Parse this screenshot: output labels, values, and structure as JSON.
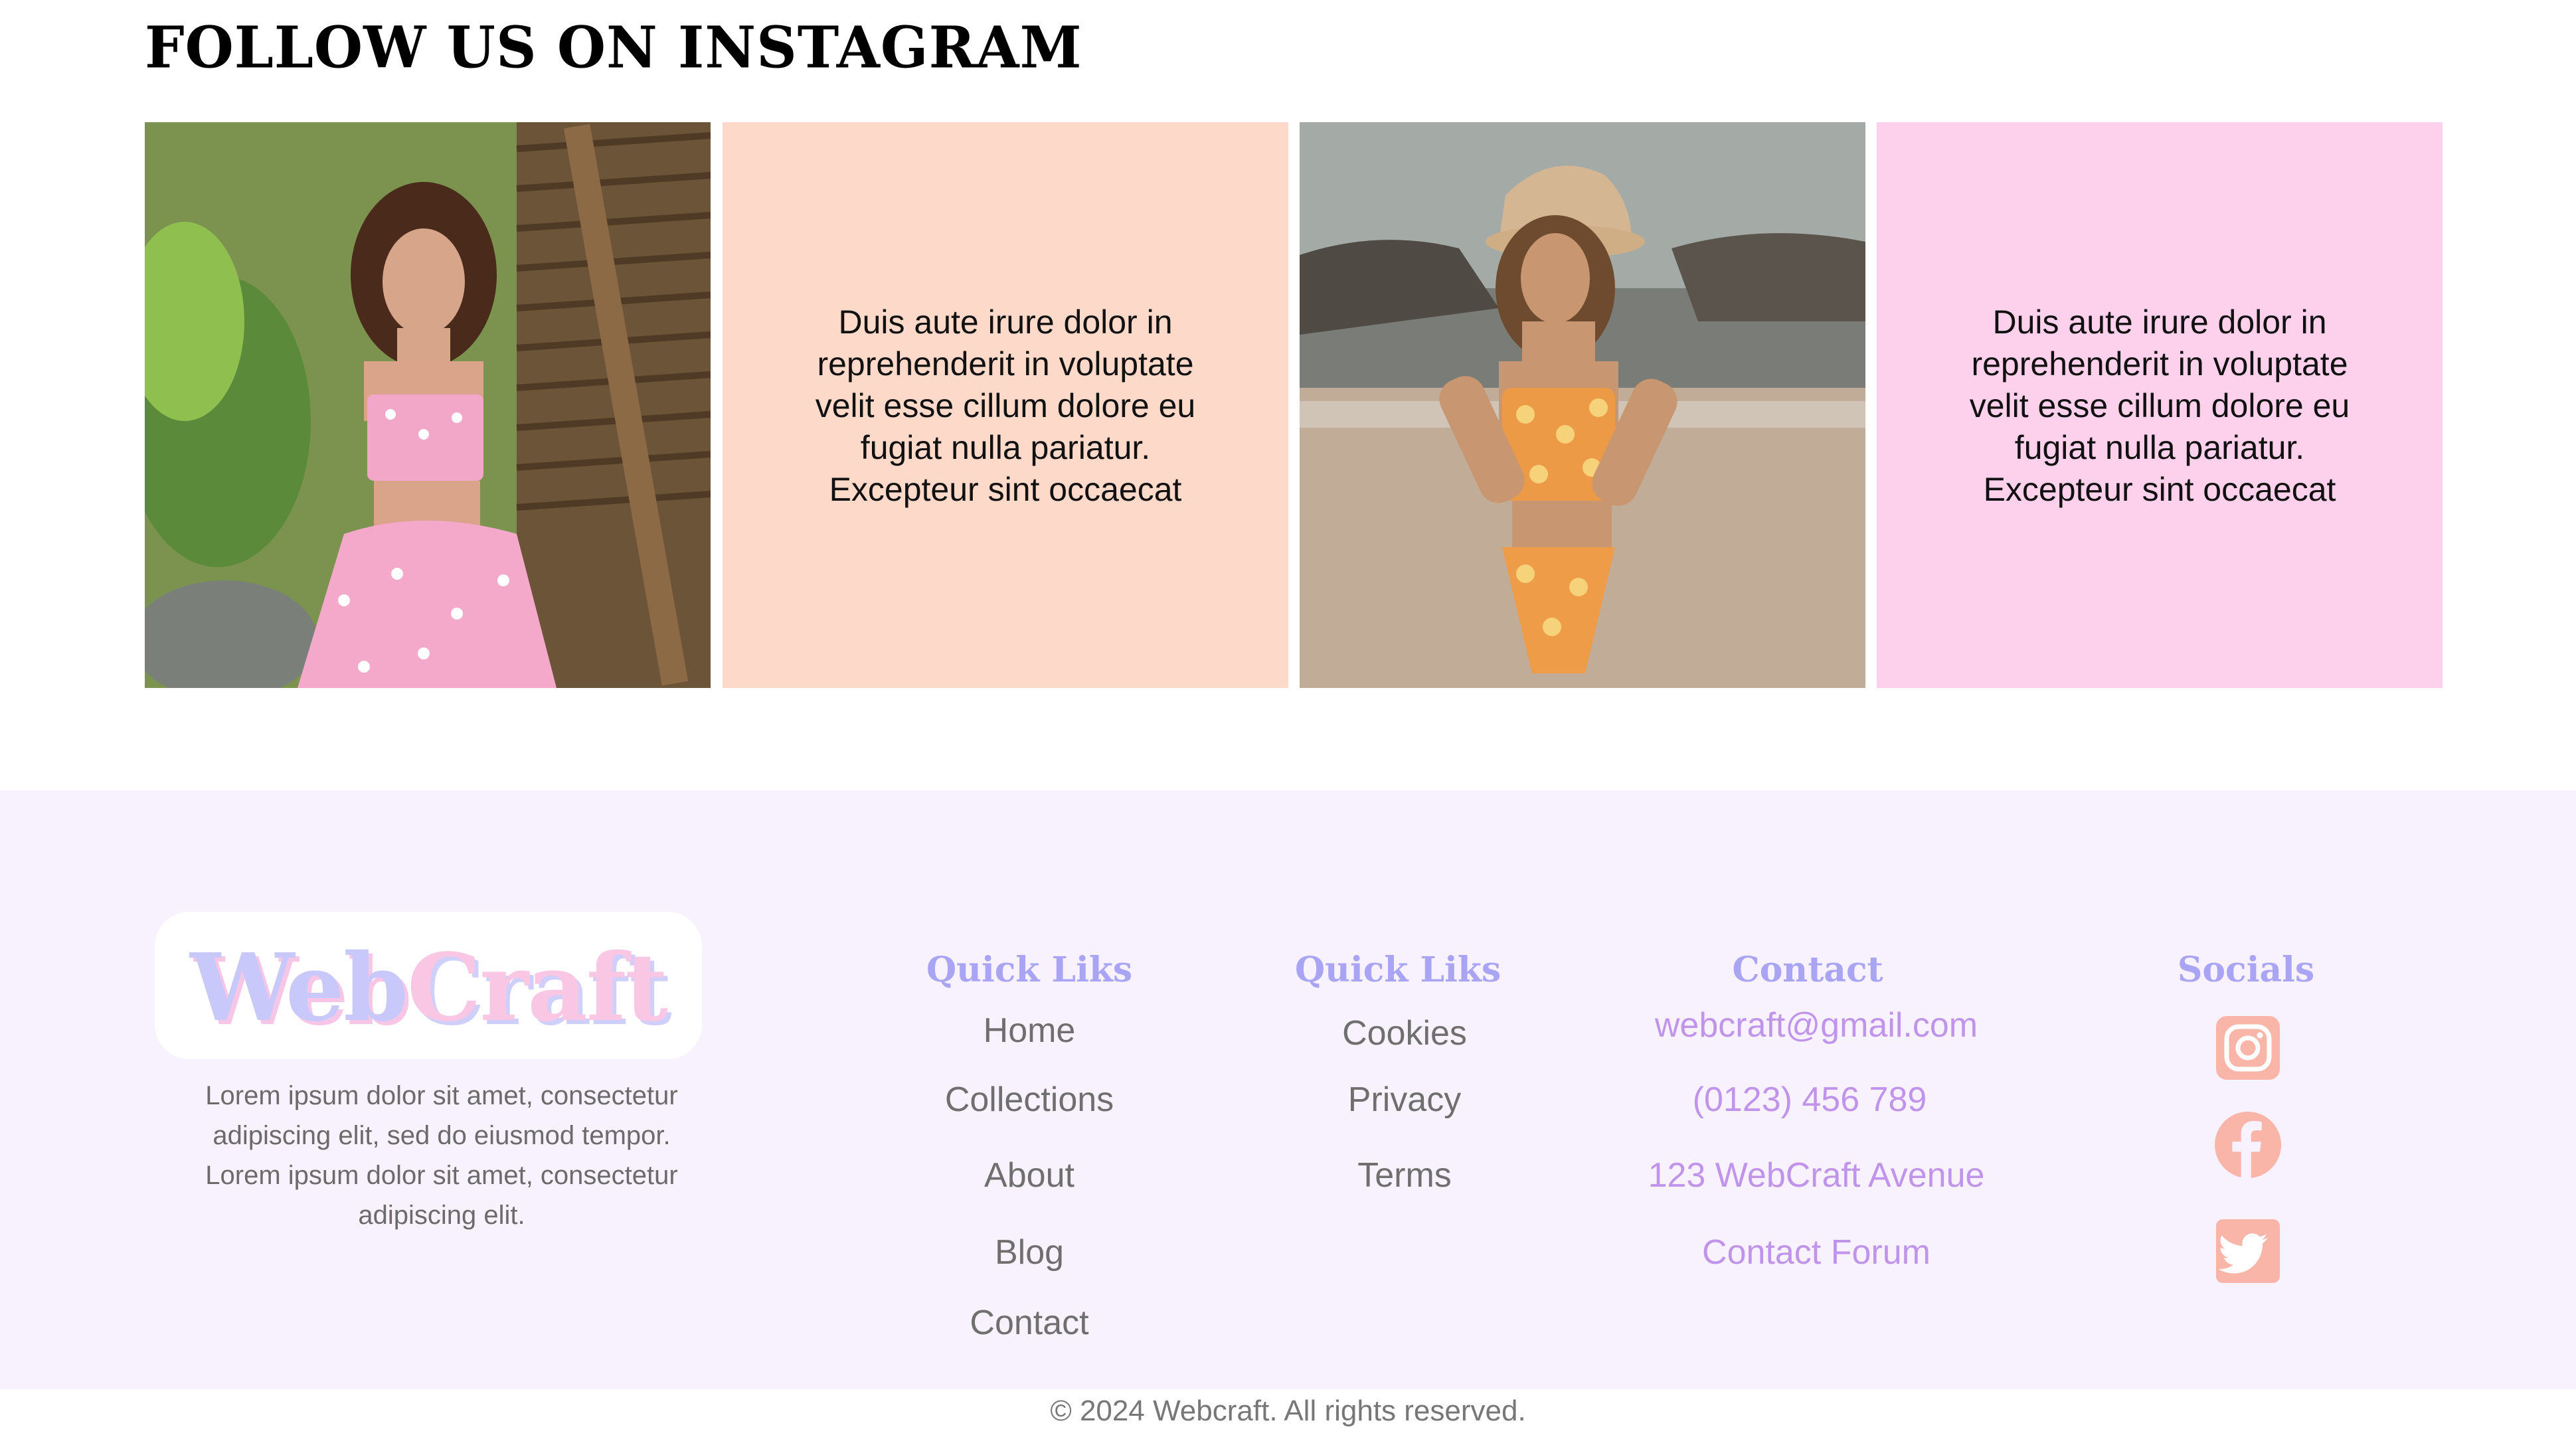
{
  "instagram": {
    "title": "FOLLOW US ON INSTAGRAM",
    "tiles": [
      {
        "type": "photo",
        "alt": ""
      },
      {
        "type": "text",
        "text": "Duis aute irure dolor in reprehenderit in voluptate velit esse cillum dolore eu fugiat nulla pariatur. Excepteur sint occaecat",
        "color": "#fdd9ca"
      },
      {
        "type": "photo",
        "alt": ""
      },
      {
        "type": "text",
        "text": "Duis aute irure dolor in reprehenderit in voluptate velit esse cillum dolore eu fugiat nulla pariatur. Excepteur sint occaecat",
        "color": "#fdd0ec"
      }
    ]
  },
  "footer": {
    "background": "#f8f1fe",
    "logo": {
      "part1": "Web",
      "part2": "Craft"
    },
    "about": "Lorem ipsum dolor sit amet, consectetur adipiscing elit, sed do eiusmod tempor. Lorem ipsum dolor sit amet, consectetur adipiscing elit.",
    "quick_links_1": {
      "heading": "Quick Liks",
      "items": [
        "Home",
        "Collections",
        "About",
        "Blog",
        "Contact"
      ]
    },
    "quick_links_2": {
      "heading": "Quick Liks",
      "items": [
        "Cookies",
        "Privacy",
        "Terms"
      ]
    },
    "contact": {
      "heading": "Contact",
      "items": [
        "webcraft@gmail.com",
        "(0123) 456 789",
        "123 WebCraft Avenue",
        "Contact Forum"
      ]
    },
    "socials": {
      "heading": "Socials",
      "icons": [
        "instagram-icon",
        "facebook-icon",
        "twitter-icon"
      ],
      "color": "#f9b5a8"
    },
    "copyright": "© 2024 Webcraft. All rights reserved."
  }
}
